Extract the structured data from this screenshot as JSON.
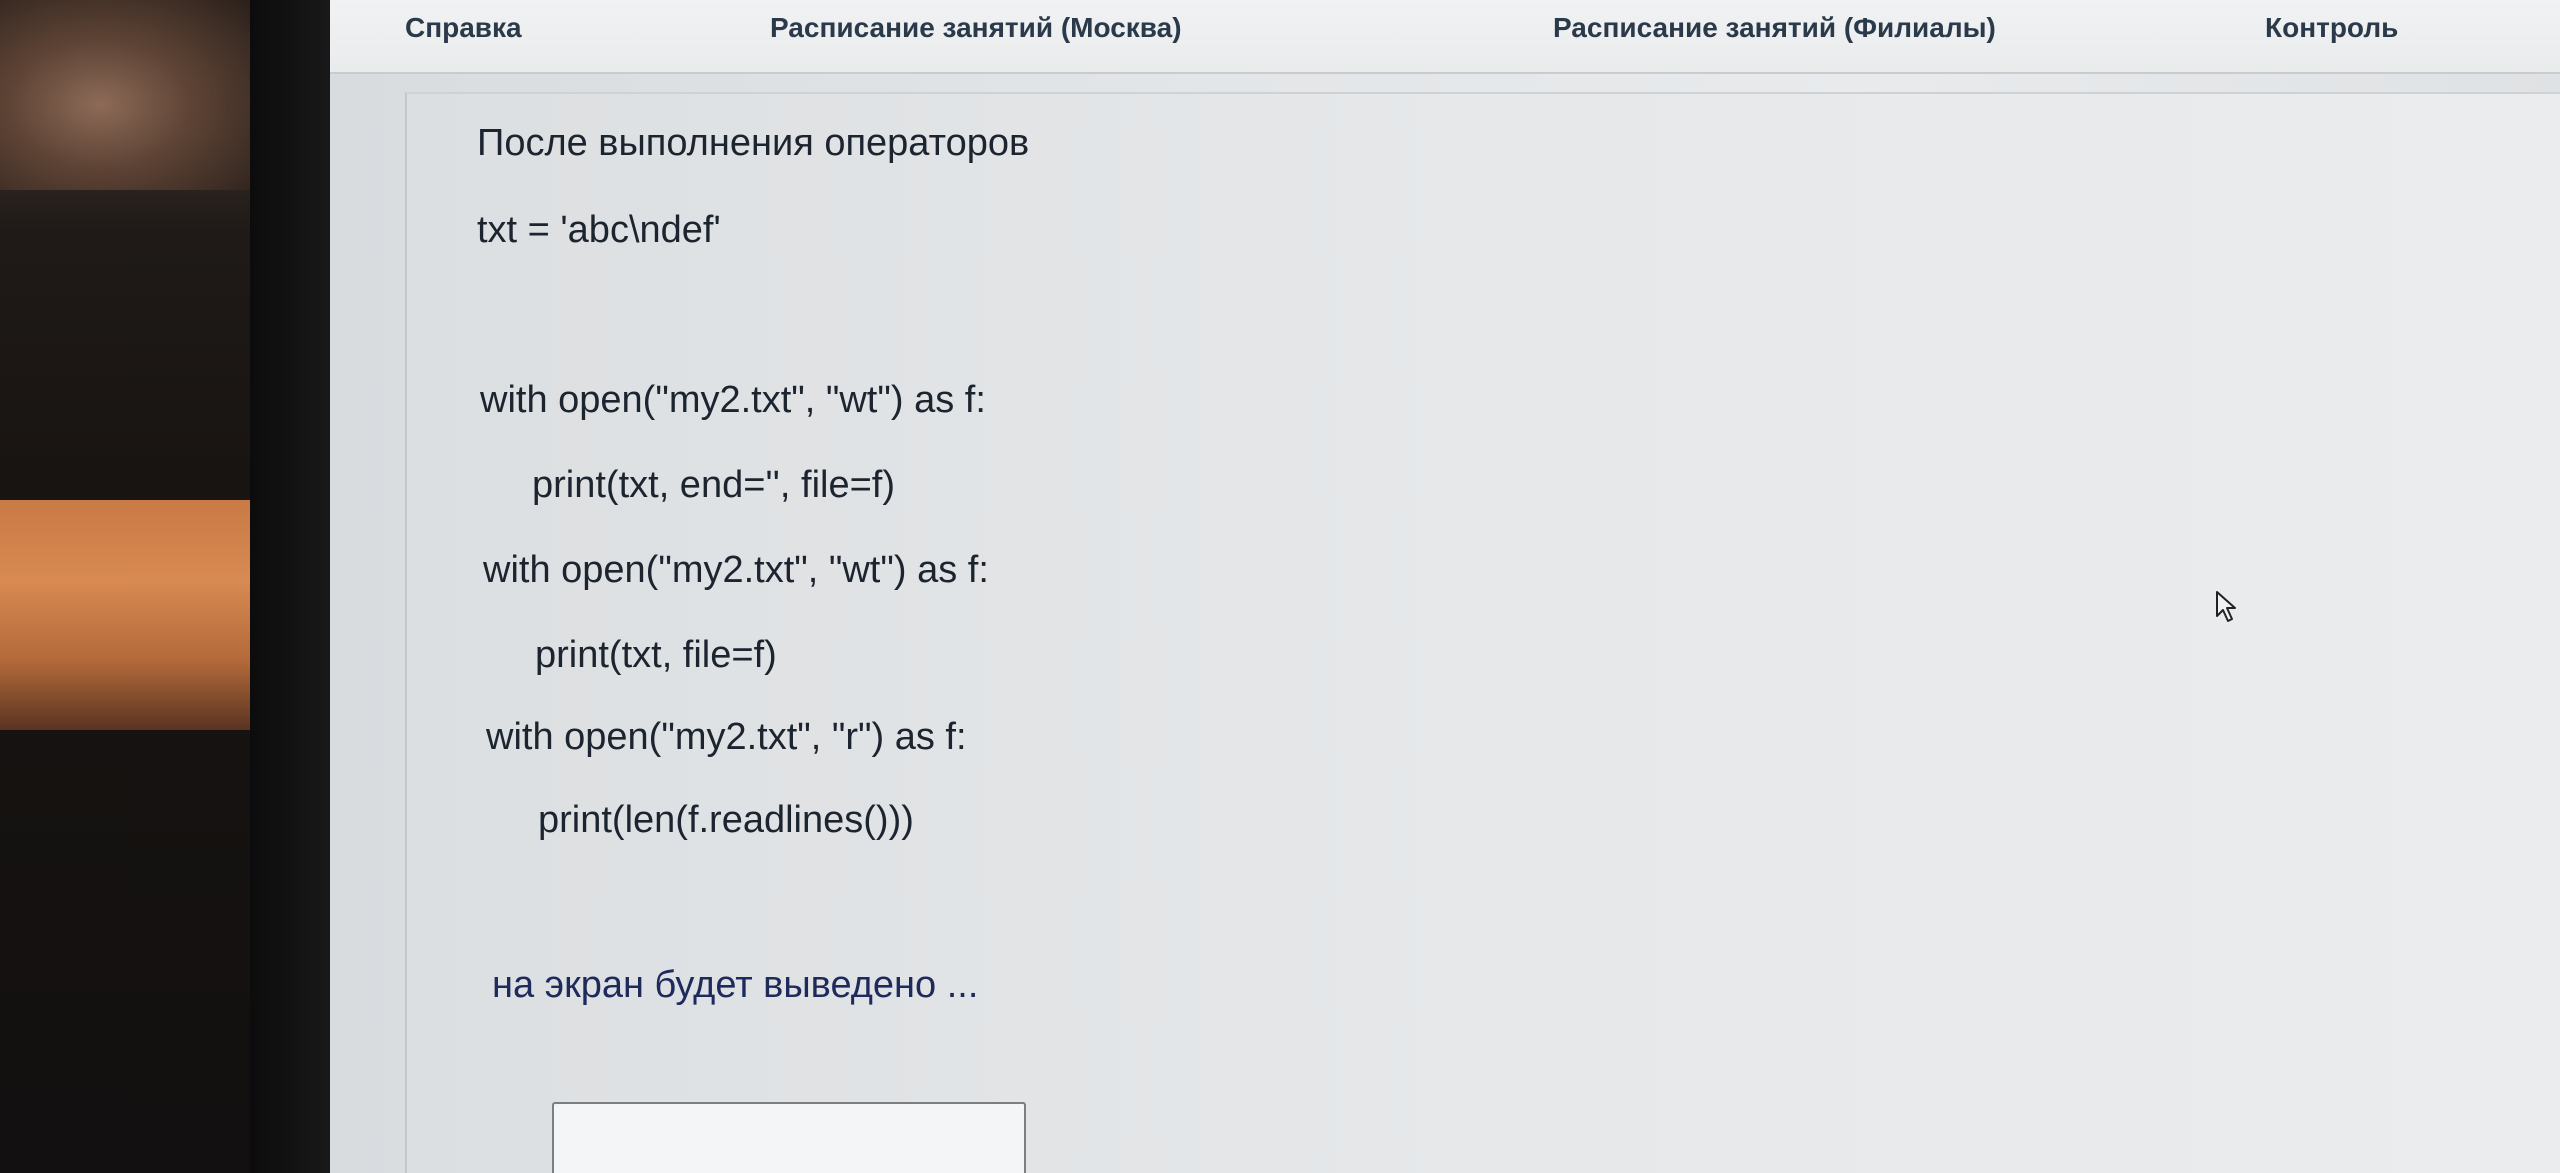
{
  "nav": {
    "items": [
      {
        "label": "Справка"
      },
      {
        "label": "Расписание занятий (Москва)"
      },
      {
        "label": "Расписание занятий (Филиалы)"
      },
      {
        "label": "Контроль"
      }
    ]
  },
  "question": {
    "intro": "После выполнения операторов",
    "code": [
      "txt = 'abc\\ndef'",
      "with open(\"my2.txt\", \"wt\") as f:",
      "print(txt, end='', file=f)",
      "with open(\"my2.txt\", \"wt\") as f:",
      "print(txt, file=f)",
      "with open(\"my2.txt\", \"r\") as f:",
      "print(len(f.readlines()))"
    ],
    "outro": "на экран будет выведено ..."
  },
  "answer": {
    "value": ""
  },
  "icons": {
    "cursor": "mouse-pointer-icon"
  }
}
